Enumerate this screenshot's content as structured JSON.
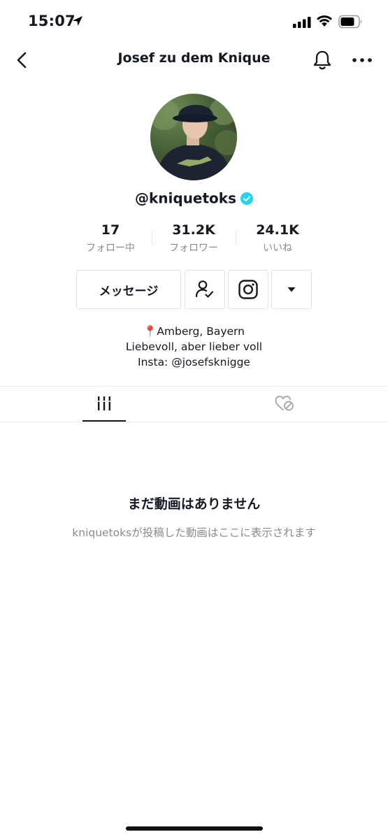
{
  "status_bar": {
    "time": "15:07"
  },
  "header": {
    "title": "Josef zu dem Knique"
  },
  "profile": {
    "username": "@kniquetoks",
    "stats": [
      {
        "value": "17",
        "label": "フォロー中"
      },
      {
        "value": "31.2K",
        "label": "フォロワー"
      },
      {
        "value": "24.1K",
        "label": "いいね"
      }
    ],
    "message_button": "メッセージ",
    "bio_lines": [
      "📍Amberg, Bayern",
      "Liebevoll, aber lieber voll",
      "Insta: @josefsknigge"
    ]
  },
  "empty_state": {
    "title": "まだ動画はありません",
    "subtitle": "kniquetoksが投稿した動画はここに表示されます"
  },
  "colors": {
    "text": "#161823",
    "secondary": "#8a8b91",
    "verified": "#20d5ec",
    "border": "#e3e3e4"
  }
}
